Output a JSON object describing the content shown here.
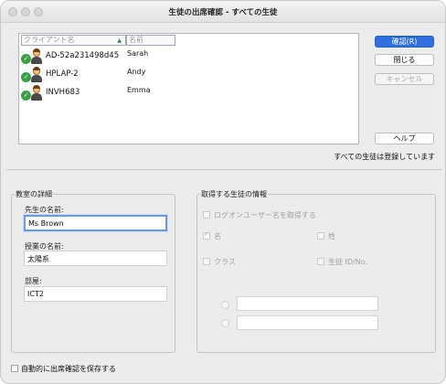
{
  "window": {
    "title": "生徒の出席確認 - すべての生徒"
  },
  "list": {
    "columns": {
      "client": "クライアント名",
      "name": "名前"
    },
    "rows": [
      {
        "client": "AD-52a231498d45",
        "name": "Sarah"
      },
      {
        "client": "HPLAP-2",
        "name": "Andy"
      },
      {
        "client": "INVH683",
        "name": "Emma"
      }
    ]
  },
  "buttons": {
    "confirm": "確認(R)",
    "close": "閉じる",
    "cancel": "キャンセル",
    "help": "ヘルプ"
  },
  "status": "すべての生徒は登録しています",
  "classroom": {
    "title": "教室の詳細",
    "teacher_label": "先生の名前:",
    "teacher_value": "Ms Brown",
    "lesson_label": "授業の名前:",
    "lesson_value": "太陽系",
    "room_label": "部屋:",
    "room_value": "ICT2"
  },
  "student_info": {
    "title": "取得する生徒の情報",
    "logon": "ログオンユーザー名を取得する",
    "first_name": "名",
    "last_name": "姓",
    "class": "クラス",
    "student_id": "生徒 ID/No."
  },
  "auto_save": "自動的に出席確認を保存する",
  "colors": {
    "primary": "#2f6fe0",
    "check": "#39a04a"
  }
}
